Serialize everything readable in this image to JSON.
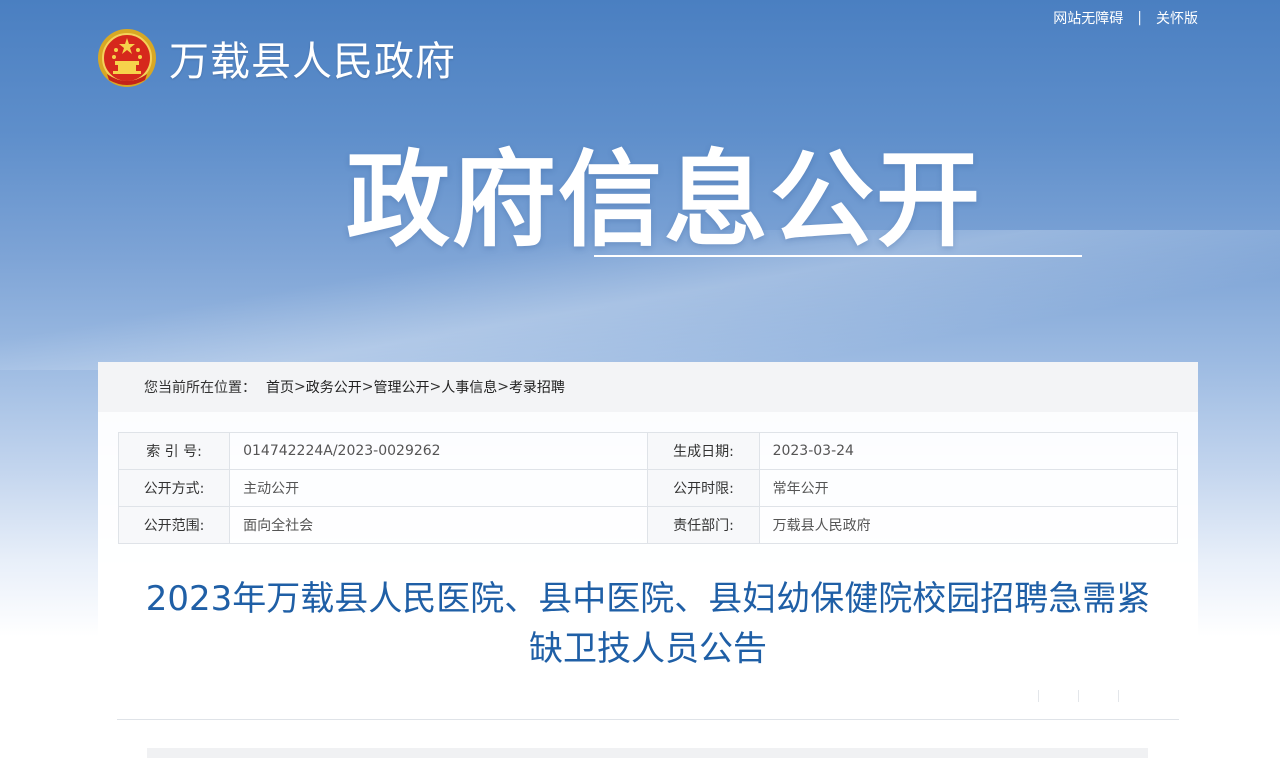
{
  "top_links": {
    "accessibility": "网站无障碍",
    "separator": "|",
    "elderly": "关怀版"
  },
  "site": {
    "name": "万载县人民政府",
    "emblem_icon": "national-emblem-icon"
  },
  "banner": {
    "title": "政府信息公开"
  },
  "breadcrumb": {
    "prefix": "您当前所在位置：",
    "items": [
      "首页",
      "政务公开",
      "管理公开",
      "人事信息",
      "考录招聘"
    ],
    "separator": ">"
  },
  "meta": {
    "rows": [
      {
        "k1": "索  引  号:",
        "v1": "014742224A/2023-0029262",
        "k2": "生成日期:",
        "v2": "2023-03-24"
      },
      {
        "k1": "公开方式:",
        "v1": "主动公开",
        "k2": "公开时限:",
        "v2": "常年公开"
      },
      {
        "k1": "公开范围:",
        "v1": "面向全社会",
        "k2": "责任部门:",
        "v2": "万载县人民政府"
      }
    ]
  },
  "article": {
    "title_line1": "2023年万载县人民医院、县中医院、县妇幼保健院校园招聘急需紧",
    "title_line2": "缺卫技人员公告"
  },
  "colors": {
    "title_blue": "#1f5fa6",
    "sky_top": "#4a7fc1"
  }
}
